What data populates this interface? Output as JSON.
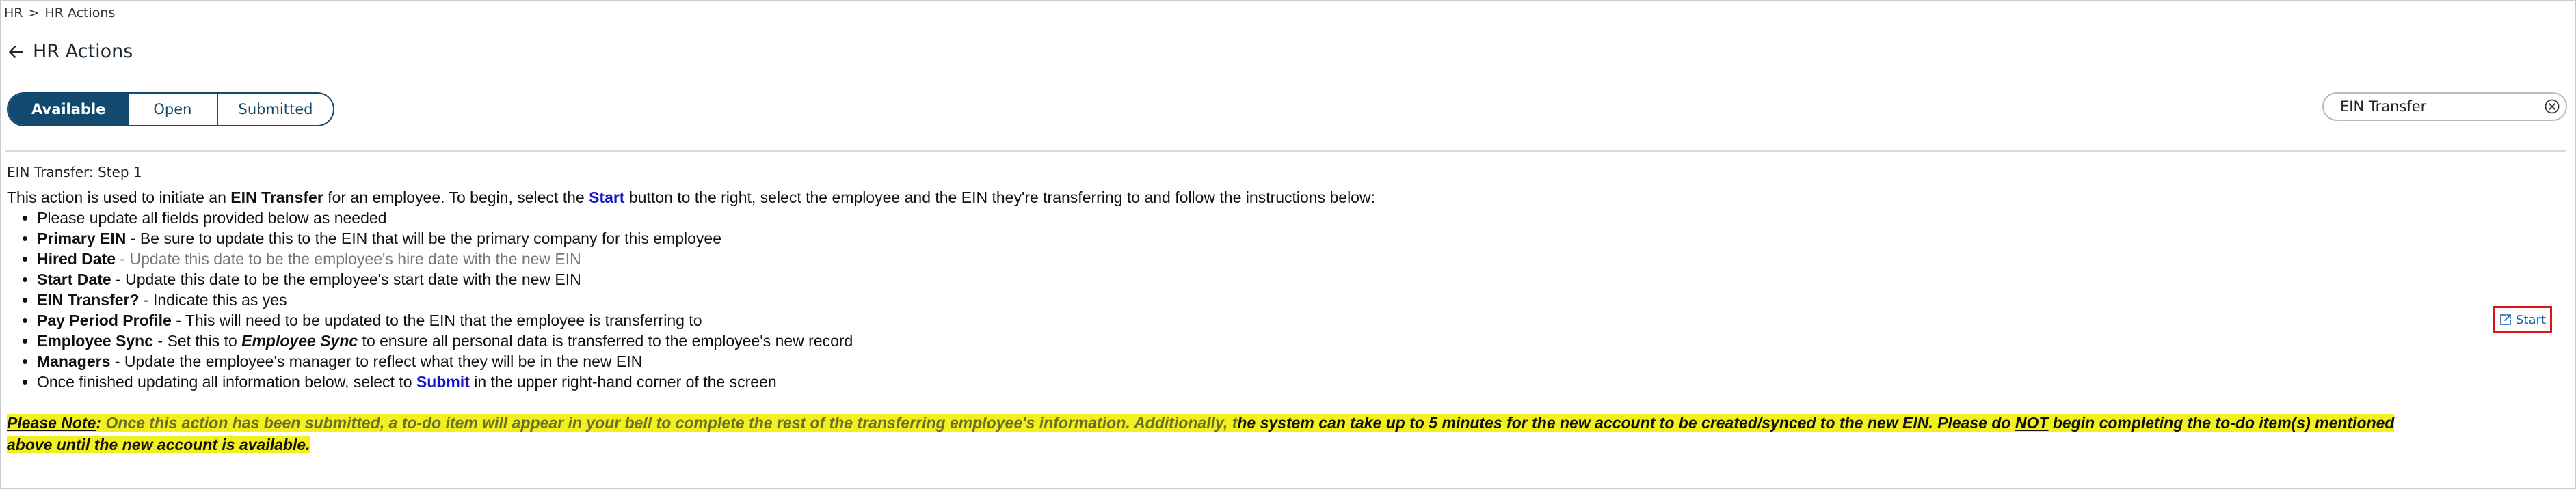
{
  "breadcrumb": {
    "root": "HR",
    "separator": ">",
    "current": "HR Actions"
  },
  "header": {
    "title": "HR Actions",
    "back_icon": "arrow-left-icon"
  },
  "tabs": [
    {
      "label": "Available",
      "active": true
    },
    {
      "label": "Open",
      "active": false
    },
    {
      "label": "Submitted",
      "active": false
    }
  ],
  "search": {
    "value": "EIN Transfer",
    "clear_icon": "clear-circle-icon"
  },
  "step": {
    "title": "EIN Transfer: Step 1"
  },
  "intro": {
    "p1": "This action is used to initiate an ",
    "b1": "EIN Transfer",
    "p2": " for an employee. To begin, select the ",
    "b2": "Start",
    "p3": " button to the right, select the employee and the EIN they're transferring to and follow the instructions below:"
  },
  "instructions": [
    {
      "text": "Please update all fields provided below as needed"
    },
    {
      "bold": "Primary EIN",
      "text": " - Be sure to update this to the EIN that will be the primary company for this employee"
    },
    {
      "bold": "Hired Date",
      "text": " - Update this date to be the employee's hire date with the new EIN"
    },
    {
      "bold": "Start Date",
      "text": " - Update this date to be the employee's start date with the new EIN"
    },
    {
      "bold": "EIN Transfer?",
      "text": " - Indicate this as yes"
    },
    {
      "bold": "Pay Period Profile",
      "text": " - This will need to be updated to the EIN that the employee is transferring to"
    },
    {
      "bold": "Employee Sync",
      "text": " - Set this to ",
      "bold_italic": "Employee Sync",
      "text2": " to ensure all personal data is transferred to the employee's new record"
    },
    {
      "bold": "Managers",
      "text": " - Update the employee's manager to reflect what they will be in the new EIN"
    },
    {
      "text": "Once finished updating all information below, select to ",
      "blue": "Submit",
      "text2": " in the upper right-hand corner of the screen"
    }
  ],
  "start_button": {
    "label": "Start",
    "icon": "external-link-icon"
  },
  "note": {
    "label": "Please Note",
    "colon": ":",
    "olive": " Once this action has been submitted, a to-do item will appear in your bell to complete the rest of the transferring employee's information. Additionally, t",
    "part2": "he system can take up to 5 minutes for the new account to be created/synced to the new EIN. Please do ",
    "not": "NOT",
    "part3": " begin completing the to-do item(s) mentioned above until the new account is available."
  },
  "colors": {
    "brand": "#12496e",
    "link": "#1a5ea8",
    "emphasis": "#1414c8",
    "highlight": "#f3f01f",
    "focus_border": "#d9141b"
  }
}
